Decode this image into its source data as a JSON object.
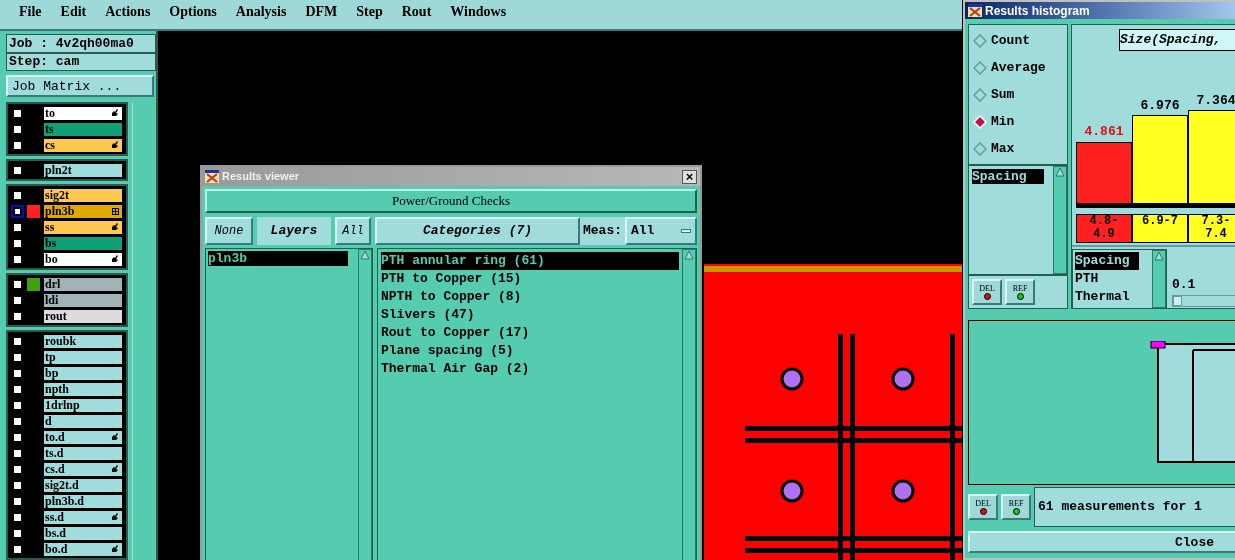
{
  "menu": [
    "File",
    "Edit",
    "Actions",
    "Options",
    "Analysis",
    "DFM",
    "Step",
    "Rout",
    "Windows"
  ],
  "job": {
    "job_label": "Job : 4v2qh00ma0",
    "step_label": "Step: cam",
    "matrix_button": "Job Matrix ..."
  },
  "layer_groups": [
    {
      "layers": [
        {
          "name": "to",
          "color": "#ffffff",
          "kind": "pen",
          "selected": false
        },
        {
          "name": "ts",
          "color": "#10a078",
          "kind": "plain",
          "selected": false
        },
        {
          "name": "cs",
          "color": "#ffc850",
          "kind": "pen",
          "selected": false
        }
      ]
    },
    {
      "layers": [
        {
          "name": "pln2t",
          "color": "#a0dcdc",
          "kind": "plain",
          "selected": false
        }
      ]
    },
    {
      "layers": [
        {
          "name": "sig2t",
          "color": "#ffc850",
          "kind": "plain",
          "selected": false
        },
        {
          "name": "pln3b",
          "color": "#dcaa00",
          "kind": "grid",
          "selected": true,
          "swatch": {
            "color": "#ff2020"
          }
        },
        {
          "name": "ss",
          "color": "#ffc850",
          "kind": "pen",
          "selected": false
        },
        {
          "name": "bs",
          "color": "#10a078",
          "kind": "plain",
          "selected": false
        },
        {
          "name": "bo",
          "color": "#ffffff",
          "kind": "pen",
          "selected": false
        }
      ]
    },
    {
      "layers": [
        {
          "name": "drl",
          "color": "#a0b4b8",
          "kind": "plain",
          "selected": false,
          "swatch": {
            "color": "#40a010"
          }
        },
        {
          "name": "ldi",
          "color": "#a0b4b8",
          "kind": "plain",
          "selected": false
        },
        {
          "name": "rout",
          "color": "#dcdcdc",
          "kind": "plain",
          "selected": false
        }
      ]
    },
    {
      "layers": [
        {
          "name": "roubk",
          "color": "#a0dcdc",
          "kind": "plain",
          "selected": false
        },
        {
          "name": "tp",
          "color": "#a0dcdc",
          "kind": "plain",
          "selected": false
        },
        {
          "name": "bp",
          "color": "#a0dcdc",
          "kind": "plain",
          "selected": false
        },
        {
          "name": "npth",
          "color": "#a0dcdc",
          "kind": "plain",
          "selected": false
        },
        {
          "name": "1drlnp",
          "color": "#a0dcdc",
          "kind": "plain",
          "selected": false
        },
        {
          "name": "d",
          "color": "#a0dcdc",
          "kind": "plain",
          "selected": false
        },
        {
          "name": "to.d",
          "color": "#a0dcdc",
          "kind": "pen",
          "selected": false
        },
        {
          "name": "ts.d",
          "color": "#a0dcdc",
          "kind": "plain",
          "selected": false
        },
        {
          "name": "cs.d",
          "color": "#a0dcdc",
          "kind": "pen",
          "selected": false
        },
        {
          "name": "sig2t.d",
          "color": "#a0dcdc",
          "kind": "plain",
          "selected": false
        },
        {
          "name": "pln3b.d",
          "color": "#a0dcdc",
          "kind": "plain",
          "selected": false
        },
        {
          "name": "ss.d",
          "color": "#a0dcdc",
          "kind": "pen",
          "selected": false
        },
        {
          "name": "bs.d",
          "color": "#a0dcdc",
          "kind": "plain",
          "selected": false
        },
        {
          "name": "bo.d",
          "color": "#a0dcdc",
          "kind": "pen",
          "selected": false
        }
      ]
    }
  ],
  "results_viewer": {
    "title": "Results viewer",
    "close": "×",
    "check_button": "Power/Ground Checks",
    "none_button": "None",
    "layers_header": "Layers",
    "all_button": "All",
    "categories_header": "Categories (7)",
    "meas_label": "Meas:",
    "meas_value": "All",
    "layers": [
      {
        "name": "pln3b",
        "selected": true
      }
    ],
    "categories": [
      {
        "name": "PTH annular ring (61)",
        "selected": true
      },
      {
        "name": "PTH to Copper (15)",
        "selected": false
      },
      {
        "name": "NPTH to Copper (8)",
        "selected": false
      },
      {
        "name": "Slivers (47)",
        "selected": false
      },
      {
        "name": "Rout to Copper (17)",
        "selected": false
      },
      {
        "name": "Plane spacing (5)",
        "selected": false
      },
      {
        "name": "Thermal Air Gap (2)",
        "selected": false
      }
    ]
  },
  "histogram": {
    "title": "Results histogram",
    "modes": [
      {
        "label": "Count",
        "selected": false
      },
      {
        "label": "Average",
        "selected": false
      },
      {
        "label": "Sum",
        "selected": false
      },
      {
        "label": "Min",
        "selected": true
      },
      {
        "label": "Max",
        "selected": false
      }
    ],
    "measures": [
      {
        "name": "Spacing",
        "selected": true
      }
    ],
    "upper_buttons": [
      "DEL",
      "REF"
    ],
    "bars": [
      {
        "color": "#ff2020"
      },
      {
        "color": "#ffff20"
      },
      {
        "color": "#ffff20"
      }
    ],
    "chart_data": {
      "type": "bar",
      "title": "Size(Spacing,",
      "categories": [
        "4.8-4.9",
        "6.9-7",
        "7.3-7.4"
      ],
      "values": [
        4.861,
        6.976,
        7.364
      ],
      "data_labels": true
    },
    "types": [
      {
        "name": "Spacing",
        "selected": true
      },
      {
        "name": "PTH",
        "selected": false
      },
      {
        "name": "Thermal",
        "selected": false
      }
    ],
    "scale": {
      "value": "0.1",
      "level": 0.15
    },
    "lower_buttons": [
      "DEL",
      "REF"
    ],
    "status": "61 measurements for 1",
    "close_button": "Close"
  }
}
